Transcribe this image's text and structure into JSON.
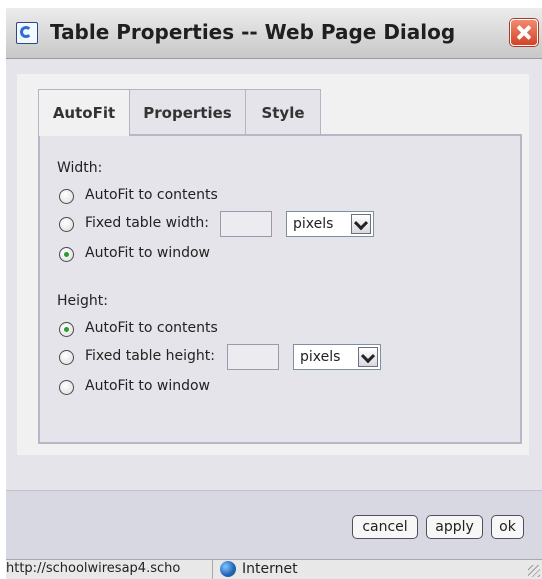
{
  "window": {
    "title": "Table Properties -- Web Page Dialog"
  },
  "tabs": [
    {
      "label": "AutoFit"
    },
    {
      "label": "Properties"
    },
    {
      "label": "Style"
    }
  ],
  "width_section": {
    "label": "Width:",
    "options": [
      {
        "label": "AutoFit to contents",
        "checked": false
      },
      {
        "label": "Fixed table width:",
        "checked": false,
        "value": "",
        "unit": "pixels"
      },
      {
        "label": "AutoFit to window",
        "checked": true
      }
    ]
  },
  "height_section": {
    "label": "Height:",
    "options": [
      {
        "label": "AutoFit to contents",
        "checked": true
      },
      {
        "label": "Fixed table height:",
        "checked": false,
        "value": "",
        "unit": "pixels"
      },
      {
        "label": "AutoFit to window",
        "checked": false
      }
    ]
  },
  "buttons": {
    "cancel": "cancel",
    "apply": "apply",
    "ok": "ok"
  },
  "statusbar": {
    "url": "http://schoolwiresap4.scho",
    "zone": "Internet"
  },
  "colors": {
    "close_button": "#d4432a",
    "radio_selected": "#2d9b2d"
  }
}
